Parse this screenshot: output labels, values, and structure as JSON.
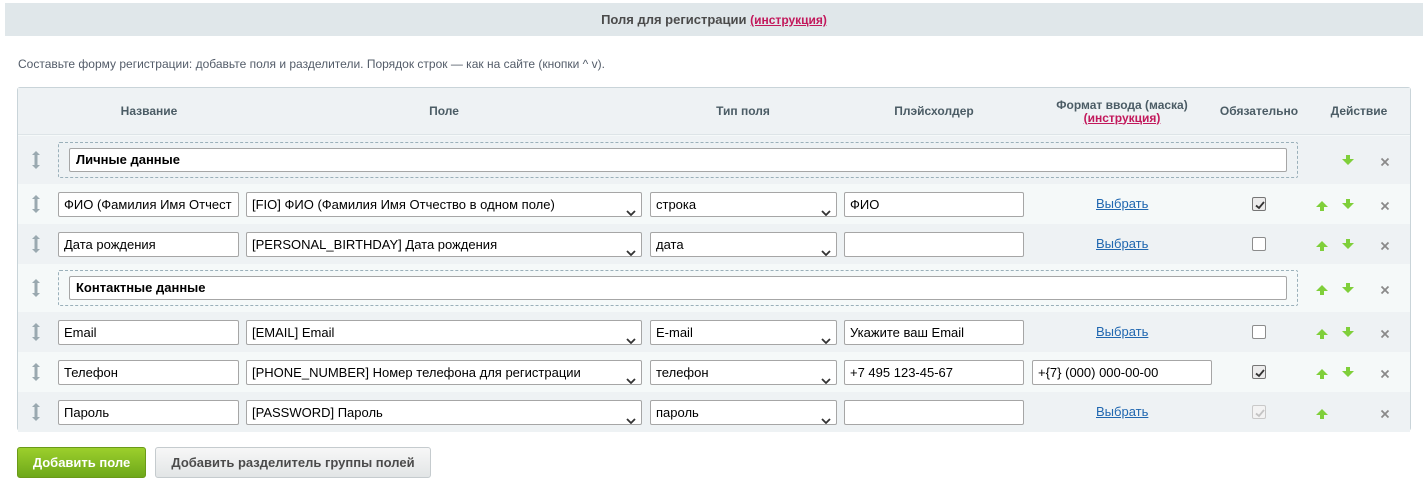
{
  "header": {
    "title": "Поля для регистрации",
    "link": "(инструкция)"
  },
  "hint": "Составьте форму регистрации: добавьте поля и разделители. Порядок строк — как на сайте (кнопки ^ v).",
  "columns": {
    "name": "Название",
    "field": "Поле",
    "type": "Тип поля",
    "placeholder": "Плэйсхолдер",
    "mask": "Формат ввода (маска)",
    "mask_link": "(инструкция)",
    "required": "Обязательно",
    "action": "Действие"
  },
  "rows": [
    {
      "kind": "separator",
      "label": "Личные данные"
    },
    {
      "kind": "field",
      "name": "ФИО (Фамилия Имя Отчест",
      "field": "[FIO] ФИО (Фамилия Имя Отчество в одном поле)",
      "type": "строка",
      "placeholder": "ФИО",
      "mask": "Выбрать",
      "required": true
    },
    {
      "kind": "field",
      "name": "Дата рождения",
      "field": "[PERSONAL_BIRTHDAY] Дата рождения",
      "type": "дата",
      "placeholder": "",
      "mask": "Выбрать",
      "required": false
    },
    {
      "kind": "separator",
      "label": "Контактные данные"
    },
    {
      "kind": "field",
      "name": "Email",
      "field": "[EMAIL] Email",
      "type": "E-mail",
      "placeholder": "Укажите ваш Email",
      "mask": "Выбрать",
      "required": false
    },
    {
      "kind": "field",
      "name": "Телефон",
      "field": "[PHONE_NUMBER] Номер телефона для регистрации",
      "type": "телефон",
      "placeholder": "+7 495 123-45-67",
      "mask": "+{7} (000) 000-00-00",
      "required": true
    },
    {
      "kind": "field",
      "name": "Пароль",
      "field": "[PASSWORD] Пароль",
      "type": "пароль",
      "placeholder": "",
      "mask": "Выбрать",
      "required": true
    }
  ],
  "buttons": {
    "add_field": "Добавить поле",
    "add_separator": "Добавить разделитель группы полей"
  },
  "colors": {
    "accent_green": "#7ab51d",
    "link_blue": "#2067b0",
    "link_red": "#c2185b",
    "arrow_green": "#7fcf3a"
  }
}
